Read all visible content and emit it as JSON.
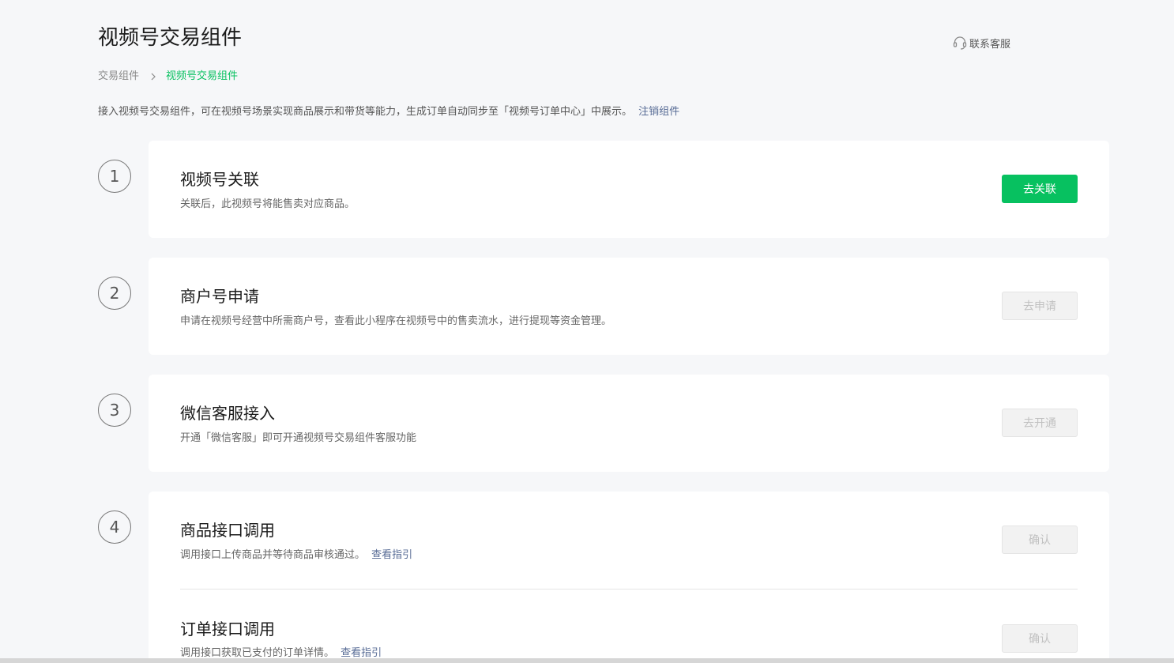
{
  "header": {
    "title": "视频号交易组件",
    "support_label": "联系客服",
    "support_icon": "headset-icon"
  },
  "breadcrumb": {
    "parent": "交易组件",
    "current": "视频号交易组件",
    "separator_icon": "chevron-right-icon"
  },
  "intro": {
    "text": "接入视频号交易组件，可在视频号场景实现商品展示和带货等能力，生成订单自动同步至「视频号订单中心」中展示。",
    "link": "注销组件"
  },
  "colors": {
    "accent": "#07c160",
    "link": "#576b95",
    "background": "#f6f7f9"
  },
  "steps": [
    {
      "number": "1",
      "title": "视频号关联",
      "desc": "关联后，此视频号将能售卖对应商品。",
      "button": "去关联",
      "button_state": "enabled"
    },
    {
      "number": "2",
      "title": "商户号申请",
      "desc": "申请在视频号经营中所需商户号，查看此小程序在视频号中的售卖流水，进行提现等资金管理。",
      "button": "去申请",
      "button_state": "disabled"
    },
    {
      "number": "3",
      "title": "微信客服接入",
      "desc": "开通「微信客服」即可开通视频号交易组件客服功能",
      "button": "去开通",
      "button_state": "disabled"
    },
    {
      "number": "4",
      "items": [
        {
          "title": "商品接口调用",
          "desc": "调用接口上传商品并等待商品审核通过。",
          "link": "查看指引",
          "button": "确认",
          "button_state": "disabled"
        },
        {
          "title": "订单接口调用",
          "desc": "调用接口获取已支付的订单详情。",
          "link": "查看指引",
          "button": "确认",
          "button_state": "disabled"
        }
      ]
    }
  ]
}
